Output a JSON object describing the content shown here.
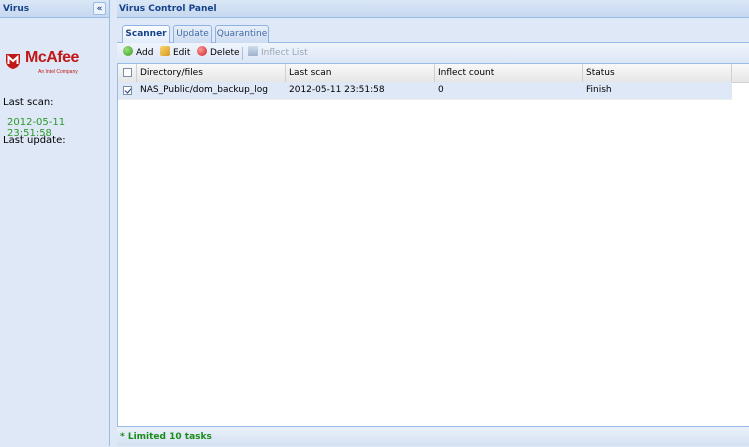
{
  "left_panel": {
    "title": "Virus",
    "collapse_glyph": "«",
    "logo": {
      "text": "McAfee",
      "subtext": "An Intel Company"
    },
    "last_scan_label": "Last scan:",
    "last_scan_value": "2012-05-11 23:51:58",
    "last_update_label": "Last update:"
  },
  "main_panel": {
    "title": "Virus Control Panel",
    "tabs": [
      {
        "label": "Scanner",
        "active": true
      },
      {
        "label": "Update",
        "active": false
      },
      {
        "label": "Quarantine",
        "active": false
      }
    ],
    "toolbar": {
      "add": {
        "label": "Add",
        "icon": "add-circle-icon"
      },
      "edit": {
        "label": "Edit",
        "icon": "pencil-icon"
      },
      "delete": {
        "label": "Delete",
        "icon": "delete-circle-icon"
      },
      "inflect_list": {
        "label": "Inflect List",
        "icon": "list-icon",
        "disabled": true
      }
    },
    "grid": {
      "columns": [
        "Directory/files",
        "Last scan",
        "Inflect count",
        "Status"
      ],
      "rows": [
        {
          "checked": true,
          "directory": "NAS_Public/dom_backup_log",
          "last_scan": "2012-05-11 23:51:58",
          "inflect_count": "0",
          "status": "Finish"
        }
      ]
    },
    "footer": "* Limited 10 tasks"
  },
  "colors": {
    "header_text": "#15428b",
    "panel_bg": "#dfe8f6",
    "border": "#99bbe8",
    "brand_red": "#c01818",
    "green_text": "#2a9a2a"
  }
}
